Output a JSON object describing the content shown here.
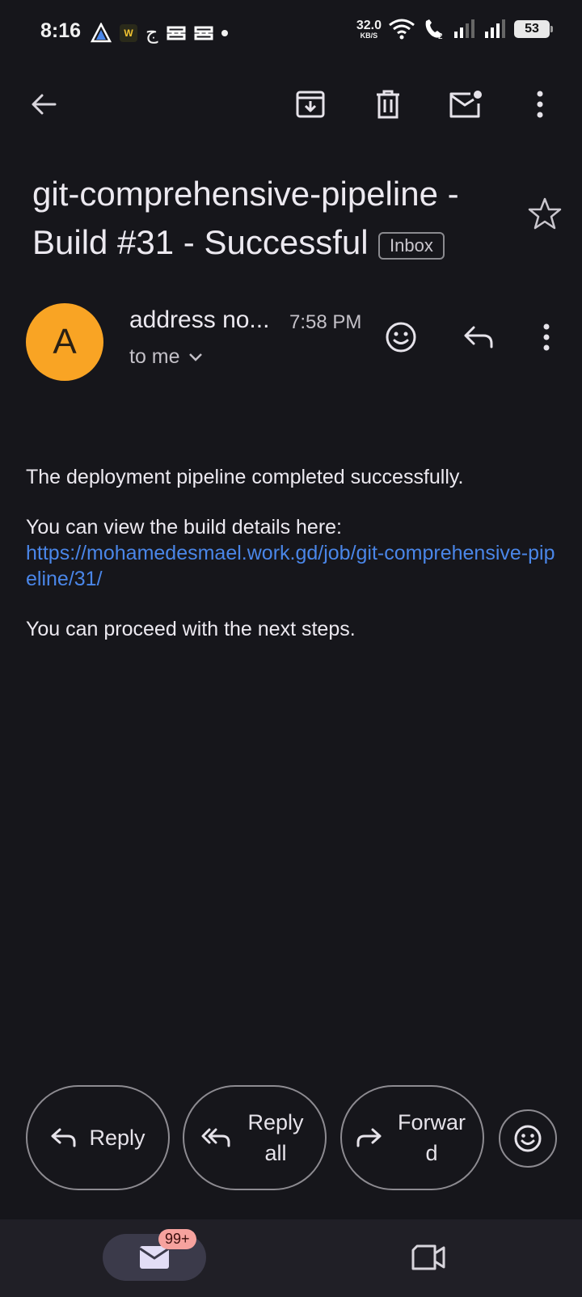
{
  "status_bar": {
    "time": "8:16",
    "arabic_glyph": "ج",
    "w_badge": "W",
    "net_speed_value": "32.0",
    "net_speed_unit": "KB/S",
    "sim_label": "2",
    "battery": "53"
  },
  "toolbar": {
    "back": "back-arrow-icon",
    "archive": "archive-icon",
    "delete": "trash-icon",
    "mark_unread": "mark-unread-icon",
    "more": "more-vert-icon"
  },
  "email": {
    "subject": "git-comprehensive-pipeline - Build #31 - Successful",
    "label_chip": "Inbox",
    "sender_initial": "A",
    "sender_name": "address no...",
    "time": "7:58 PM",
    "recipient": "to me",
    "body_line1": "The deployment pipeline completed successfully.",
    "body_line2": "You can view the build details here:",
    "body_link": "https://mohamedesmael.work.gd/job/git-comprehensive-pipeline/31/",
    "body_line3": "You can proceed with the next steps."
  },
  "actions": {
    "reply": "Reply",
    "reply_all": "Reply all",
    "forward": "Forward"
  },
  "nav": {
    "mail_badge": "99+"
  },
  "colors": {
    "background": "#16161b",
    "avatar": "#f9a424",
    "link": "#4a86e8",
    "badge": "#f6a29e"
  }
}
